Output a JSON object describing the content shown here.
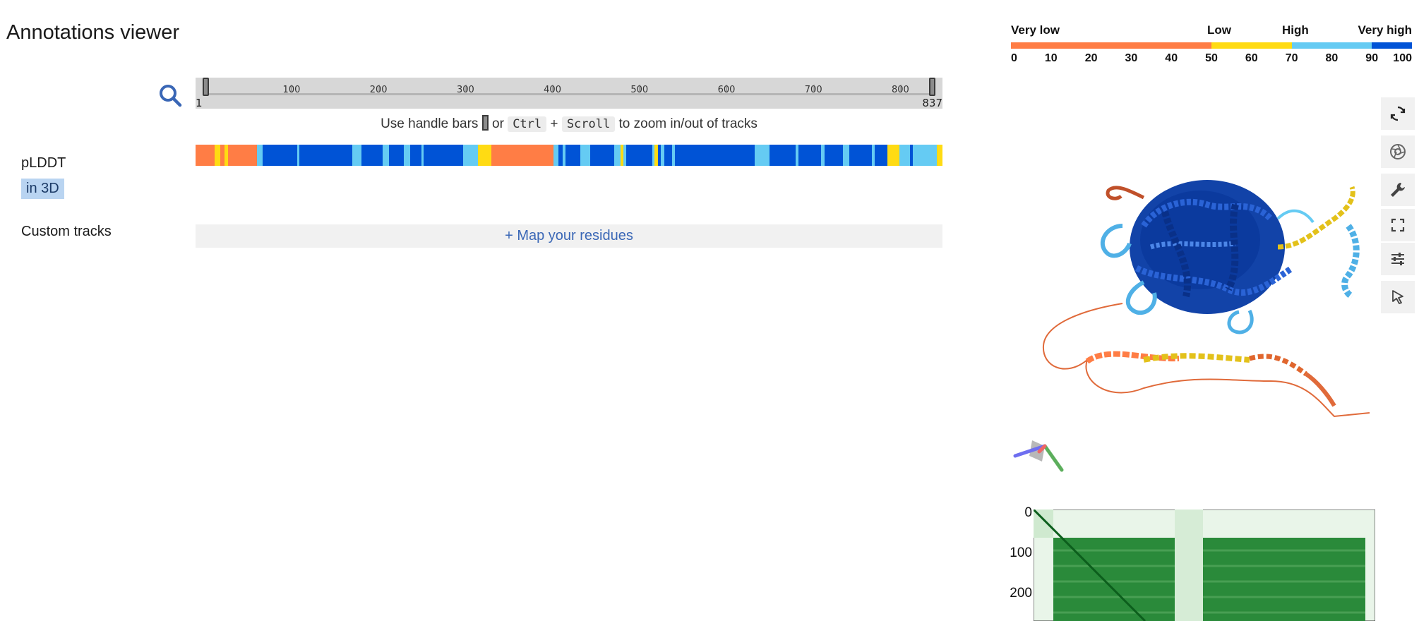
{
  "title": "Annotations viewer",
  "navigator": {
    "start_label": "1",
    "end_label": "837",
    "ticks": [
      "100",
      "200",
      "300",
      "400",
      "500",
      "600",
      "700",
      "800"
    ]
  },
  "help": {
    "prefix": "Use handle bars",
    "or": "or",
    "ctrl": "Ctrl",
    "plus": "+",
    "scroll": "Scroll",
    "suffix": "to zoom in/out of tracks"
  },
  "tracks": {
    "plddt_label": "pLDDT",
    "in3d_label": "in 3D",
    "custom_label": "Custom tracks",
    "map_button": "+ Map your residues"
  },
  "legend": {
    "categories": [
      "Very low",
      "Low",
      "High",
      "Very high"
    ],
    "ticks": [
      "0",
      "10",
      "20",
      "30",
      "40",
      "50",
      "60",
      "70",
      "80",
      "90",
      "100"
    ],
    "colors": {
      "very_low": "#FF7D45",
      "low": "#FFDB13",
      "high": "#65CBF3",
      "very_high": "#0053D6"
    }
  },
  "plddt_segments": [
    {
      "c": "very_low",
      "w": 2.5
    },
    {
      "c": "low",
      "w": 0.8
    },
    {
      "c": "very_low",
      "w": 0.5
    },
    {
      "c": "low",
      "w": 0.5
    },
    {
      "c": "very_low",
      "w": 3.8
    },
    {
      "c": "high",
      "w": 0.8
    },
    {
      "c": "very_high",
      "w": 4.5
    },
    {
      "c": "high",
      "w": 0.3
    },
    {
      "c": "very_high",
      "w": 7
    },
    {
      "c": "high",
      "w": 1.2
    },
    {
      "c": "very_high",
      "w": 2.8
    },
    {
      "c": "high",
      "w": 0.8
    },
    {
      "c": "very_high",
      "w": 2
    },
    {
      "c": "high",
      "w": 0.8
    },
    {
      "c": "very_high",
      "w": 1.5
    },
    {
      "c": "high",
      "w": 0.3
    },
    {
      "c": "very_high",
      "w": 5.2
    },
    {
      "c": "high",
      "w": 2
    },
    {
      "c": "low",
      "w": 1.8
    },
    {
      "c": "very_low",
      "w": 8.2
    },
    {
      "c": "high",
      "w": 0.6
    },
    {
      "c": "very_high",
      "w": 0.6
    },
    {
      "c": "high",
      "w": 0.3
    },
    {
      "c": "very_high",
      "w": 2
    },
    {
      "c": "high",
      "w": 1.3
    },
    {
      "c": "very_high",
      "w": 3.2
    },
    {
      "c": "high",
      "w": 0.8
    },
    {
      "c": "low",
      "w": 0.4
    },
    {
      "c": "high",
      "w": 0.4
    },
    {
      "c": "very_high",
      "w": 3.4
    },
    {
      "c": "high",
      "w": 0.3
    },
    {
      "c": "low",
      "w": 0.5
    },
    {
      "c": "very_high",
      "w": 0.3
    },
    {
      "c": "high",
      "w": 0.5
    },
    {
      "c": "very_high",
      "w": 1
    },
    {
      "c": "high",
      "w": 0.4
    },
    {
      "c": "very_high",
      "w": 10.5
    },
    {
      "c": "high",
      "w": 2
    },
    {
      "c": "very_high",
      "w": 3.4
    },
    {
      "c": "high",
      "w": 0.4
    },
    {
      "c": "very_high",
      "w": 3
    },
    {
      "c": "high",
      "w": 0.5
    },
    {
      "c": "very_high",
      "w": 2.4
    },
    {
      "c": "high",
      "w": 0.8
    },
    {
      "c": "very_high",
      "w": 3
    },
    {
      "c": "high",
      "w": 0.4
    },
    {
      "c": "very_high",
      "w": 1.7
    },
    {
      "c": "low",
      "w": 1.5
    },
    {
      "c": "high",
      "w": 1.4
    },
    {
      "c": "very_high",
      "w": 0.4
    },
    {
      "c": "high",
      "w": 3.2
    },
    {
      "c": "low",
      "w": 0.7
    }
  ],
  "toolbar": {
    "reset": "reset-icon",
    "screenshot": "camera-icon",
    "settings": "wrench-icon",
    "expand": "expand-icon",
    "controls": "sliders-icon",
    "select": "cursor-icon"
  },
  "pae": {
    "y_ticks": [
      "0",
      "100",
      "200"
    ]
  }
}
